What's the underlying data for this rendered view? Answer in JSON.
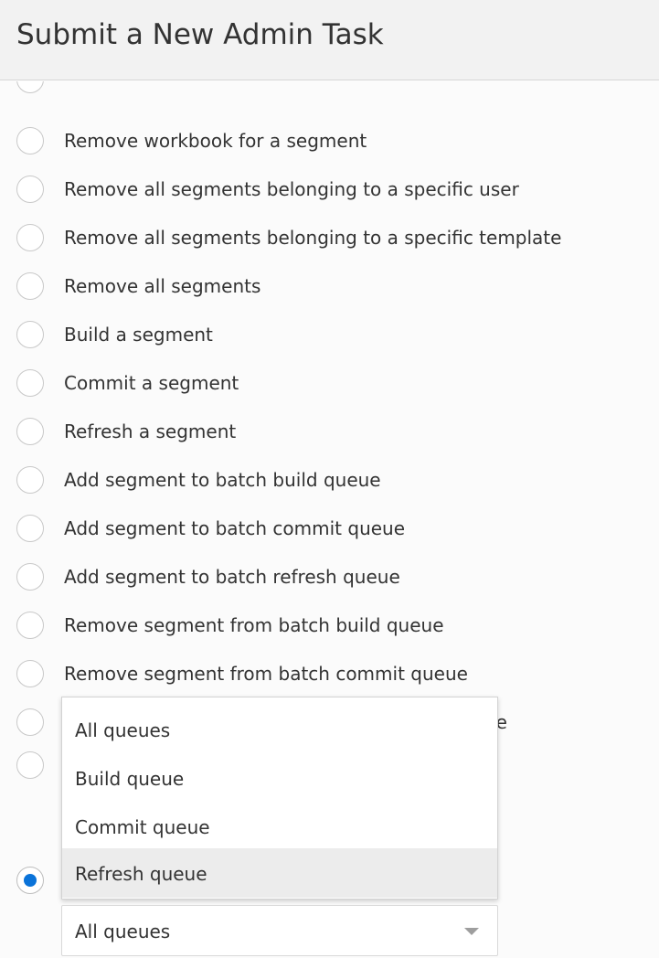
{
  "header": {
    "title": "Submit a New Admin Task"
  },
  "options": [
    {
      "label": "Remove workbook for a segment",
      "selected": false
    },
    {
      "label": "Remove all segments belonging to a specific user",
      "selected": false
    },
    {
      "label": "Remove all segments belonging to a specific template",
      "selected": false
    },
    {
      "label": "Remove all segments",
      "selected": false
    },
    {
      "label": "Build a segment",
      "selected": false
    },
    {
      "label": "Commit a segment",
      "selected": false
    },
    {
      "label": "Refresh a segment",
      "selected": false
    },
    {
      "label": "Add segment to batch build queue",
      "selected": false
    },
    {
      "label": "Add segment to batch commit queue",
      "selected": false
    },
    {
      "label": "Add segment to batch refresh queue",
      "selected": false
    },
    {
      "label": "Remove segment from batch build queue",
      "selected": false
    },
    {
      "label": "Remove segment from batch commit queue",
      "selected": false
    },
    {
      "label": "ue",
      "selected": false
    },
    {
      "label": "",
      "selected": false
    },
    {
      "label": "",
      "selected": true
    }
  ],
  "queue_select": {
    "value": "All queues",
    "options": [
      "All queues",
      "Build queue",
      "Commit queue",
      "Refresh queue"
    ],
    "highlighted": "Refresh queue"
  },
  "colors": {
    "accent": "#0a73d9",
    "header_bg": "#f2f2f2",
    "page_bg": "#fbfbfb",
    "text": "#333333",
    "highlight": "#ececec"
  }
}
